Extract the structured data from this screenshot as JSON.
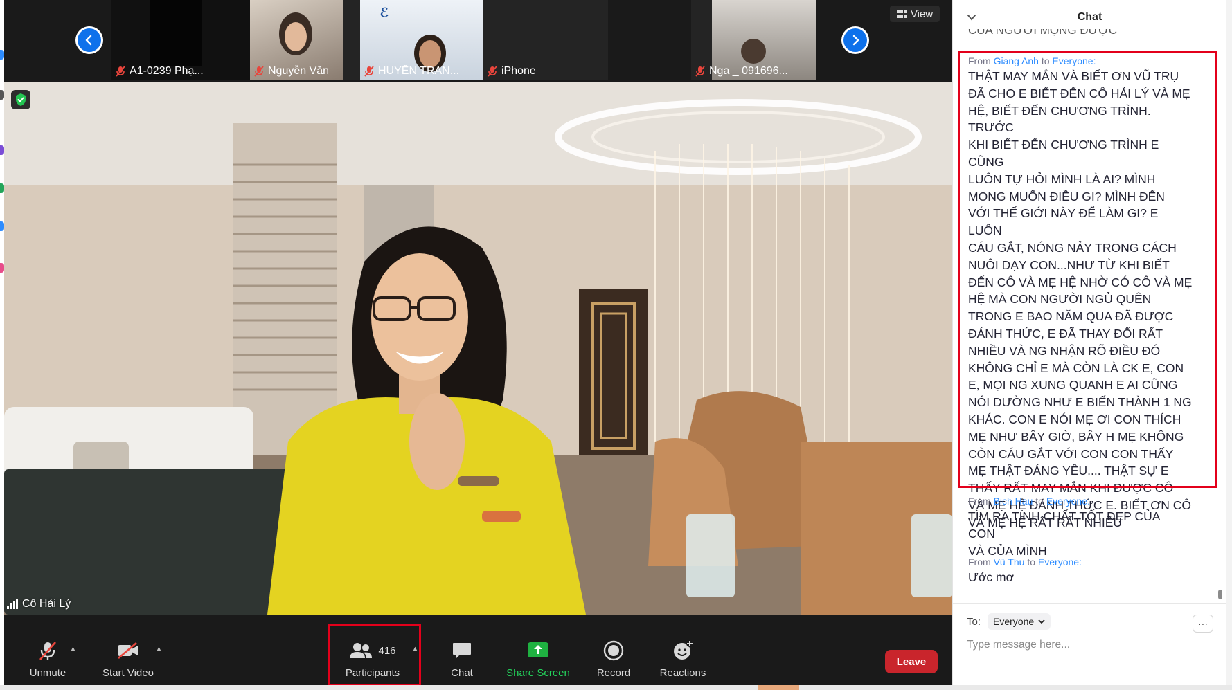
{
  "thumbnails": [
    {
      "name": "A1-0239 Phạ..."
    },
    {
      "name": "Nguyễn Văn"
    },
    {
      "name": "HUYỀN TRAN..."
    },
    {
      "name": "iPhone"
    },
    {
      "name": "Nga _ 091696..."
    }
  ],
  "view_button": {
    "label": "View",
    "icon": "grid-icon"
  },
  "main_video": {
    "speaker_name": "Cô Hải Lý"
  },
  "toolbar": {
    "unmute": "Unmute",
    "start_video": "Start Video",
    "participants": "Participants",
    "participant_count": "416",
    "chat": "Chat",
    "share_screen": "Share Screen",
    "record": "Record",
    "reactions": "Reactions",
    "leave": "Leave"
  },
  "chat": {
    "title": "Chat",
    "previous_line_fragment": "CỦA NGƯỜI MỘNG ĐƯỢC",
    "messages": [
      {
        "from_prefix": "From",
        "sender": "Giang Anh",
        "to_word": "to",
        "recipient": "Everyone:",
        "text": "THẬT MAY MẮN VÀ BIẾT ƠN VŨ TRỤ\nĐÃ CHO E BIẾT ĐẾN CÔ HẢI LÝ VÀ MẸ\nHỆ, BIẾT ĐẾN CHƯƠNG TRÌNH. TRƯỚC\nKHI BIẾT ĐẾN CHƯƠNG TRÌNH E CŨNG\nLUÔN TỰ HỎI MÌNH LÀ AI? MÌNH\nMONG MUỐN ĐIỀU GI? MÌNH ĐẾN\nVỚI THẾ GIỚI NÀY ĐỂ LÀM GI? E LUÔN\nCÁU GẮT, NÓNG NẢY TRONG CÁCH\nNUÔI DẠY CON...NHƯ TỪ KHI BIẾT\nĐẾN CÔ VÀ MẸ HỆ NHỜ CÓ CÔ VÀ MẸ\nHỆ  MÀ CON NGƯỜI NGỦ QUÊN\nTRONG E BAO NĂM QUA ĐÃ ĐƯỢC\nĐÁNH THỨC, E ĐÃ THAY ĐỔI RẤT\nNHIỀU VÀ NG NHẬN RÕ ĐIỀU ĐÓ\nKHÔNG CHỈ E MÀ CÒN LÀ CK E, CON\nE, MỌI NG XUNG QUANH E AI CŨNG\nNÓI DƯỜNG NHƯ E BIẾN THÀNH 1 NG\nKHÁC. CON E NÓI MẸ ƠI CON THÍCH\nMẸ NHƯ BÂY GIỜ, BÂY H MẸ KHÔNG\nCÒN CÁU GẮT VỚI CON CON THẤY\nMẸ THẬT ĐÁNG YÊU.... THẬT SỰ E\nTHẤY RẤT MAY MẮN KHI ĐƯỢC CÔ\nVÀ MẸ HỆ ĐÁNH THỨC E. BIẾT ƠN CÔ\nVÀ MẸ HỆ RẤT RẤT NHIỀU"
      },
      {
        "from_prefix": "From",
        "sender": "Bich Hau",
        "to_word": "to",
        "recipient": "Everyone:",
        "text": "TÌM RA TINH CHẤT TỐT ĐẸP CỦA CON\nVÀ CỦA MÌNH"
      },
      {
        "from_prefix": "From",
        "sender": "Vũ Thu",
        "to_word": "to",
        "recipient": "Everyone:",
        "text": "Ước  mơ"
      }
    ],
    "to_label": "To:",
    "to_value": "Everyone",
    "more_label": "···",
    "input_placeholder": "Type message here..."
  },
  "colors": {
    "accent_blue": "#0e71eb",
    "highlight_red": "#e3001b",
    "leave_red": "#c9252c",
    "share_green": "#1fb141",
    "sender_blue": "#2d8cff"
  }
}
